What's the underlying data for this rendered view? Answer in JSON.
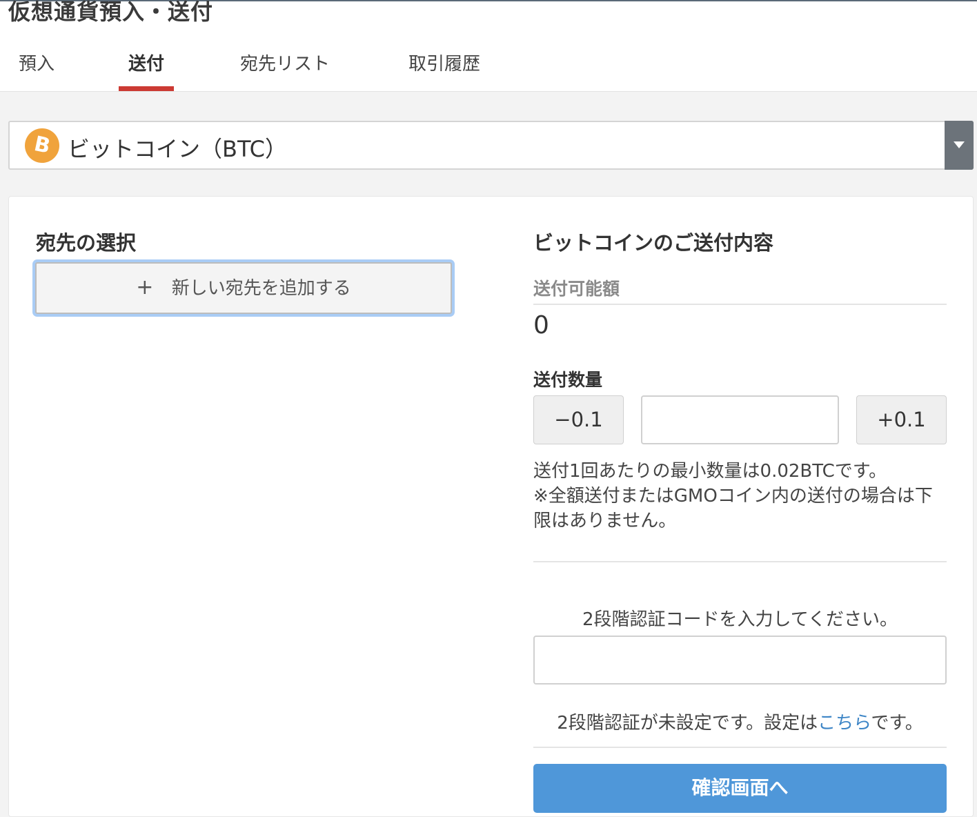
{
  "header": {
    "title": "仮想通貨預入・送付",
    "tabs": [
      {
        "label": "預入",
        "active": false
      },
      {
        "label": "送付",
        "active": true
      },
      {
        "label": "宛先リスト",
        "active": false
      },
      {
        "label": "取引履歴",
        "active": false
      }
    ],
    "accent_color": "#cc3a33"
  },
  "currency_select": {
    "icon": "bitcoin-icon",
    "icon_glyph": "B",
    "selected": "ビットコイン（BTC）"
  },
  "destination": {
    "heading": "宛先の選択",
    "add_button_plus": "+",
    "add_button_label": "新しい宛先を追加する"
  },
  "send_details": {
    "heading": "ビットコインのご送付内容",
    "available_label": "送付可能額",
    "available_value": "0",
    "quantity_label": "送付数量",
    "decrement_label": "−0.1",
    "increment_label": "+0.1",
    "quantity_value": "",
    "note_line1": "送付1回あたりの最小数量は0.02BTCです。",
    "note_line2": "※全額送付またはGMOコイン内の送付の場合は下限はありません。"
  },
  "two_factor": {
    "prompt": "2段階認証コードを入力してください。",
    "code_value": "",
    "status_prefix": "2段階認証が未設定です。設定は",
    "status_link": "こちら",
    "status_suffix": "です。"
  },
  "confirm_button": {
    "label": "確認画面へ",
    "color": "#4f97d9"
  }
}
